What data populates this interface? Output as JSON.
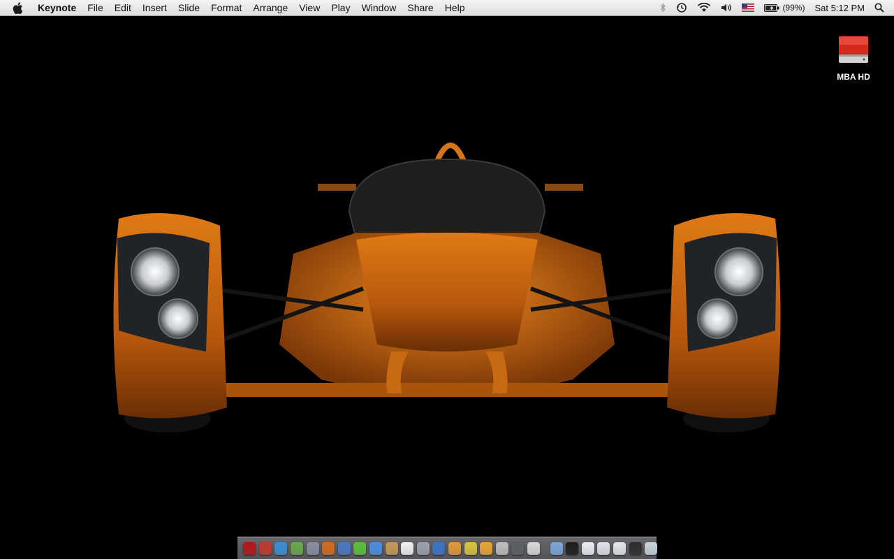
{
  "menubar": {
    "app_name": "Keynote",
    "menus": [
      "File",
      "Edit",
      "Insert",
      "Slide",
      "Format",
      "Arrange",
      "View",
      "Play",
      "Window",
      "Share",
      "Help"
    ],
    "status": {
      "battery_percent": "(99%)",
      "clock": "Sat 5:12 PM",
      "icons": [
        "bluetooth-icon",
        "time-machine-icon",
        "wifi-icon",
        "volume-icon",
        "flag-icon",
        "battery-icon",
        "spotlight-icon"
      ]
    }
  },
  "desktop": {
    "drive_label": "MBA HD",
    "wallpaper": "orange-race-car"
  },
  "dock": {
    "apps": [
      {
        "name": "dock-acrobat-icon",
        "color": "#b3161b"
      },
      {
        "name": "dock-cd-icon",
        "color": "#c0392b"
      },
      {
        "name": "dock-safari-icon",
        "color": "#3a8fd6"
      },
      {
        "name": "dock-activity-icon",
        "color": "#6aa84f"
      },
      {
        "name": "dock-utility-icon",
        "color": "#8a8fa0"
      },
      {
        "name": "dock-keynote-icon",
        "color": "#d46b1e"
      },
      {
        "name": "dock-preview-icon",
        "color": "#4b78c2"
      },
      {
        "name": "dock-frontrow-icon",
        "color": "#59c13c"
      },
      {
        "name": "dock-ichat-icon",
        "color": "#4a90e2"
      },
      {
        "name": "dock-addressbook-icon",
        "color": "#c49a5a"
      },
      {
        "name": "dock-ical-icon",
        "color": "#f3f3f3"
      },
      {
        "name": "dock-photos-icon",
        "color": "#9aa3ad"
      },
      {
        "name": "dock-itunes-icon",
        "color": "#3b73c4"
      },
      {
        "name": "dock-iphoto-icon",
        "color": "#e39a3a"
      },
      {
        "name": "dock-imovie-icon",
        "color": "#d9c53e"
      },
      {
        "name": "dock-garageband-icon",
        "color": "#e8a632"
      },
      {
        "name": "dock-blank-icon",
        "color": "#bfbfbf"
      },
      {
        "name": "dock-camera-icon",
        "color": "#5c5f66"
      },
      {
        "name": "dock-textedit-icon",
        "color": "#d9d9d9"
      }
    ],
    "stacks": [
      {
        "name": "dock-applications-stack",
        "color": "#7aa7d8"
      },
      {
        "name": "dock-terminal-icon",
        "color": "#1c1c1c"
      },
      {
        "name": "dock-documents-stack",
        "color": "#e9edf2"
      },
      {
        "name": "dock-downloads-stack",
        "color": "#dfe4ea"
      },
      {
        "name": "dock-folder-stack",
        "color": "#e3e7ec"
      },
      {
        "name": "dock-screen-stack",
        "color": "#2c2c2c"
      },
      {
        "name": "dock-trash-icon",
        "color": "#c8d4de"
      }
    ]
  }
}
